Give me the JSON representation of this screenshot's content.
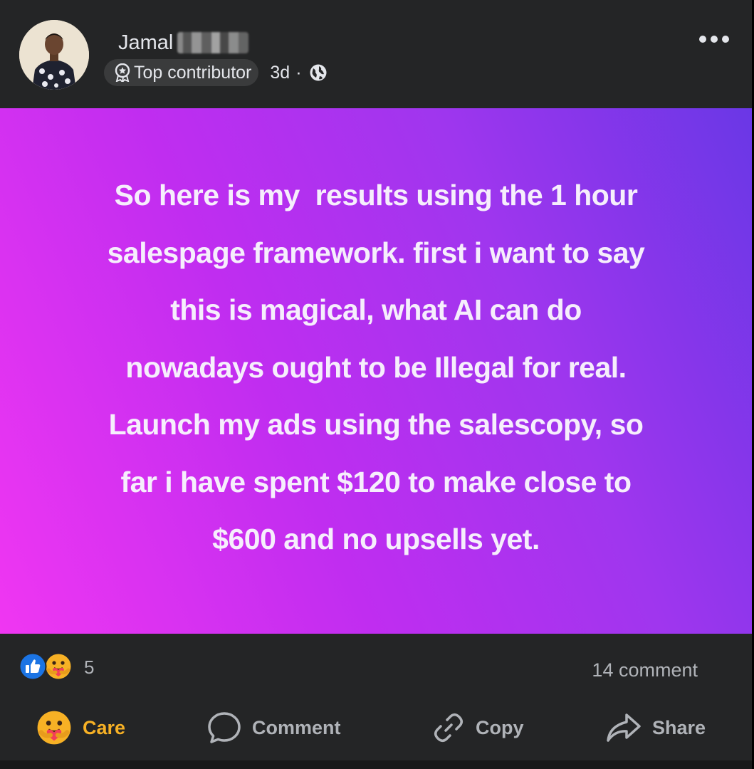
{
  "post": {
    "author": {
      "name": "Jamal",
      "badge": "Top contributor",
      "time": "3d",
      "separator": "·"
    },
    "text": "So here is my  results using the 1 hour\nsalespage framework. first i want to say\nthis is magical, what AI can do\nnowadays ought to be Illegal for real.\nLaunch my ads using the salescopy, so\nfar i have spent $120 to make close to\n$600 and no upsells yet.",
    "background_colors": [
      "#f036f2",
      "#c02df0",
      "#9f36ee",
      "#6a37e6"
    ]
  },
  "engagement": {
    "reaction_count": "5",
    "comment_count": "14 comment"
  },
  "actions": {
    "care_label": "Care",
    "comment_label": "Comment",
    "copy_label": "Copy",
    "share_label": "Share"
  },
  "icons": {
    "badge": "award-badge-icon",
    "privacy": "globe-icon",
    "more": "more-options-icon",
    "reactions": [
      "like-icon",
      "care-icon"
    ],
    "actions": [
      "care-icon",
      "comment-icon",
      "link-icon",
      "share-icon"
    ]
  },
  "colors": {
    "background": "#242526",
    "primary_text": "#e4e6eb",
    "secondary_text": "#b0b3b8",
    "care_accent": "#f7b125",
    "like_blue": "#1b74e4"
  }
}
